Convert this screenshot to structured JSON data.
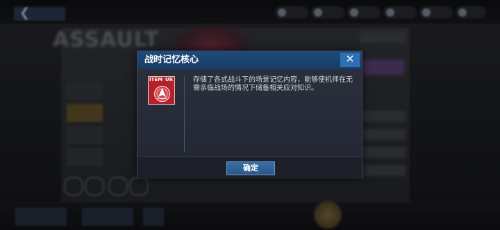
{
  "background": {
    "title": "ASSAULT",
    "back_label": "返回"
  },
  "dialog": {
    "title": "战时记忆核心",
    "close_icon": "close-icon",
    "item": {
      "tag": "ITEM",
      "rarity": "UR",
      "icon": "memory-core-emblem-icon"
    },
    "description": "存储了各式战斗下的场景记忆内容，能够使机师在无需亲临战场的情况下储备相关应对知识。",
    "confirm_label": "确定"
  },
  "colors": {
    "header_blue": "#1f4a7a",
    "item_red": "#b3212a",
    "button_blue": "#3a6fa6"
  }
}
